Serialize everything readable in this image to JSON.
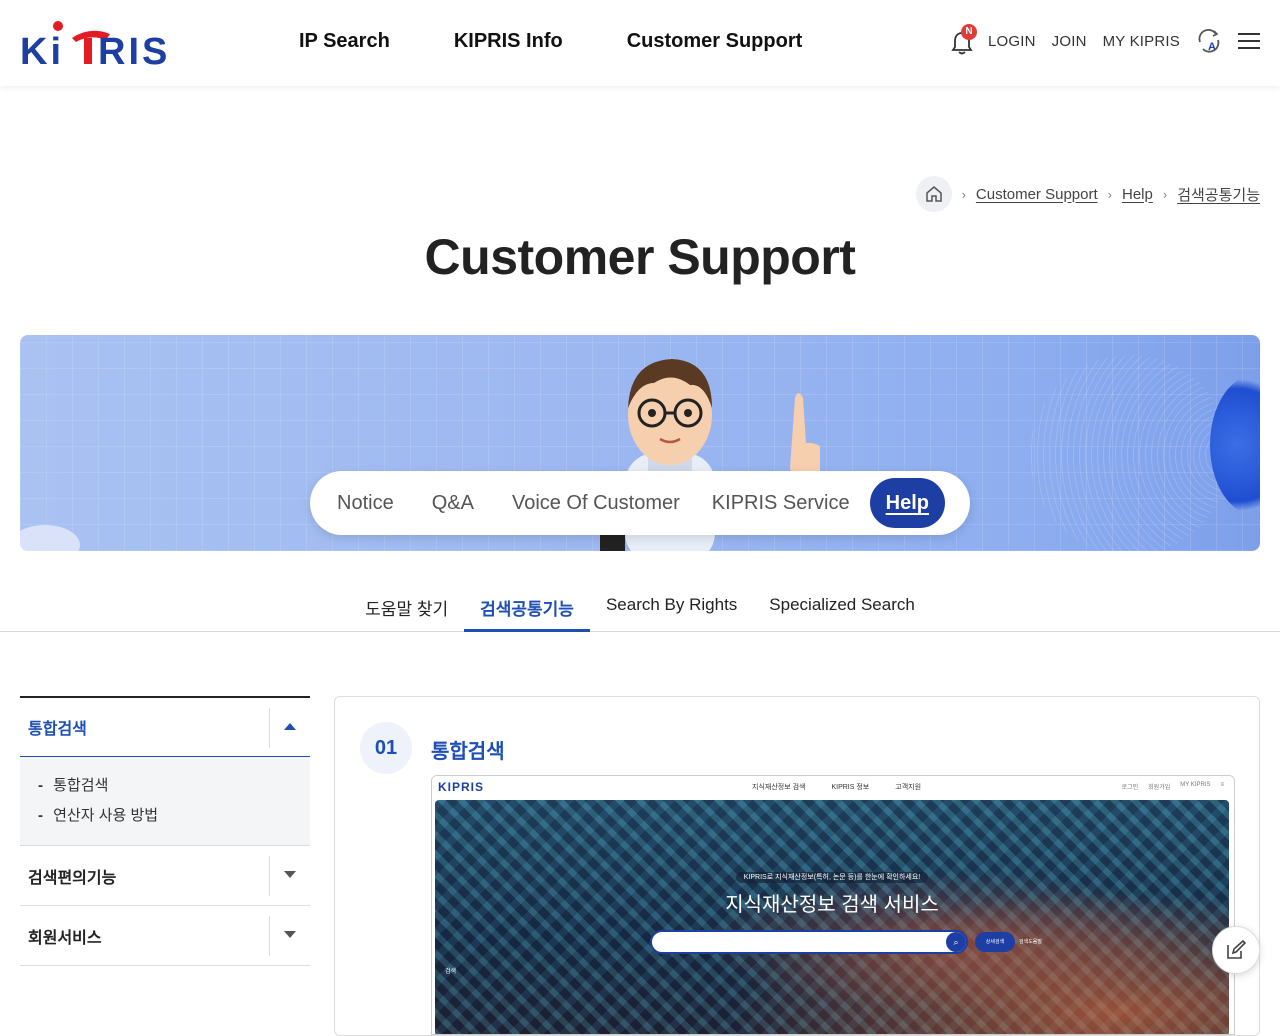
{
  "header": {
    "logo_text": "KIPRIS",
    "nav": [
      "IP Search",
      "KIPRIS Info",
      "Customer Support"
    ],
    "notification_badge": "N",
    "util_links": [
      "LOGIN",
      "JOIN",
      "MY KIPRIS"
    ]
  },
  "breadcrumb": [
    "Customer Support",
    "Help",
    "검색공통기능"
  ],
  "page_title": "Customer Support",
  "banner_tabs": [
    "Notice",
    "Q&A",
    "Voice Of Customer",
    "KIPRIS Service",
    "Help"
  ],
  "banner_tabs_active": "Help",
  "sub_tabs": [
    "도움말 찾기",
    "검색공통기능",
    "Search By Rights",
    "Specialized Search"
  ],
  "sub_tabs_active": "검색공통기능",
  "side_menu": [
    {
      "label": "통합검색",
      "open": true,
      "items": [
        "통합검색",
        "연산자 사용 방법"
      ]
    },
    {
      "label": "검색편의기능",
      "open": false,
      "items": []
    },
    {
      "label": "회원서비스",
      "open": false,
      "items": []
    }
  ],
  "section": {
    "number": "01",
    "title": "통합검색"
  },
  "screenshot": {
    "logo": "KIPRIS",
    "nav": [
      "지식재산정보 검색",
      "KIPRIS 정보",
      "고객지원"
    ],
    "util": [
      "로그인",
      "회원가입",
      "MY KIPRIS"
    ],
    "hero_small": "KIPRIS로 지식재산정보(특허, 논문 등)를 한눈에 확인하세요!",
    "hero_title": "지식재산정보 검색 서비스",
    "hero_button": "상세검색",
    "hero_link": "검색도움말",
    "hero_side": "검색"
  },
  "colors": {
    "brand": "#1d3fa3",
    "accent": "#1d4fb5",
    "logo_red": "#e31b23"
  }
}
